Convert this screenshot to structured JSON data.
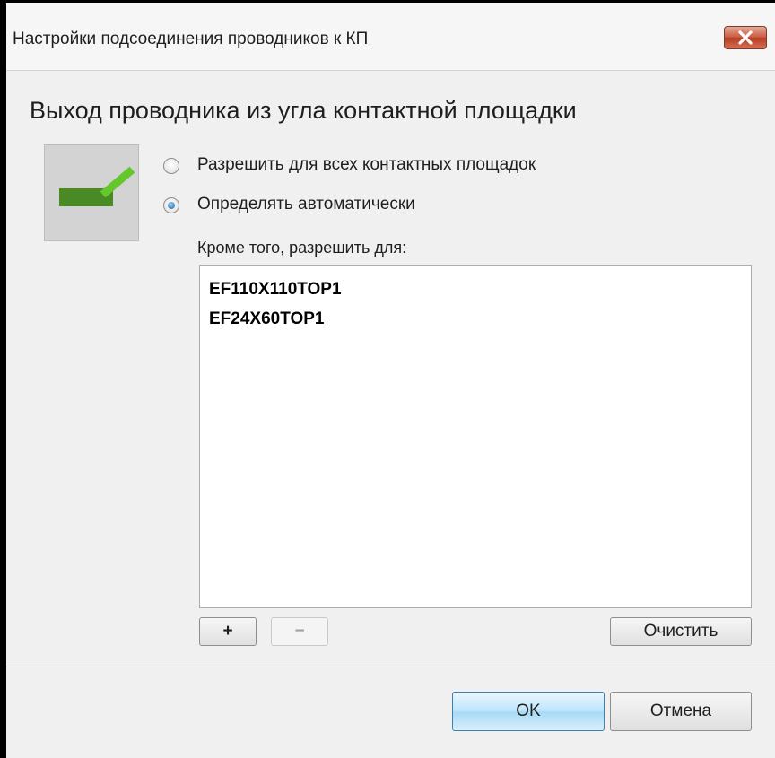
{
  "window": {
    "title": "Настройки подсоединения проводников к КП"
  },
  "heading": "Выход проводника из угла контактной площадки",
  "preview": {
    "icon": "pad-angle-trace-icon",
    "pad_color": "#4a8a25",
    "trace_color": "#64c82c"
  },
  "options": [
    {
      "label": "Разрешить для всех контактных площадок",
      "checked": false
    },
    {
      "label": "Определять автоматически",
      "checked": true
    }
  ],
  "exceptions": {
    "label": "Кроме того, разрешить для:",
    "items": [
      "EF110X110TOP1",
      "EF24X60TOP1"
    ],
    "add_label": "+",
    "remove_label": "−",
    "clear_label": "Очистить"
  },
  "buttons": {
    "ok_label": "OK",
    "cancel_label": "Отмена"
  },
  "colors": {
    "accent": "#3c7fb1",
    "close": "#c95b3f"
  }
}
